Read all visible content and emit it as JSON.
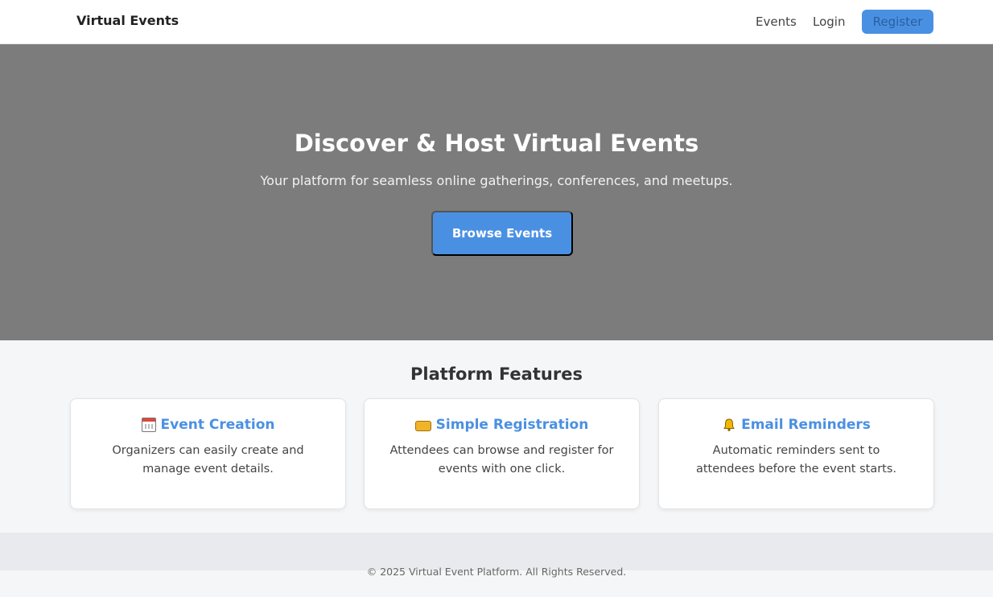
{
  "nav": {
    "brand": "Virtual Events",
    "links": [
      "Events",
      "Login"
    ],
    "register_label": "Register"
  },
  "hero": {
    "title": "Discover & Host Virtual Events",
    "subtitle": "Your platform for seamless online gatherings, conferences, and meetups.",
    "cta_label": "Browse Events"
  },
  "features": {
    "title": "Platform Features",
    "cards": [
      {
        "icon": "calendar-icon",
        "title": "Event Creation",
        "text": "Organizers can easily create and manage event details."
      },
      {
        "icon": "ticket-icon",
        "title": "Simple Registration",
        "text": "Attendees can browse and register for events with one click."
      },
      {
        "icon": "bell-icon",
        "title": "Email Reminders",
        "text": "Automatic reminders sent to attendees before the event starts."
      }
    ]
  },
  "footer": {
    "copyright": "© 2025 Virtual Event Platform. All Rights Reserved."
  },
  "colors": {
    "accent": "#4a90e2",
    "hero_bg": "#7b7c7b",
    "page_bg": "#f4f6f8"
  }
}
